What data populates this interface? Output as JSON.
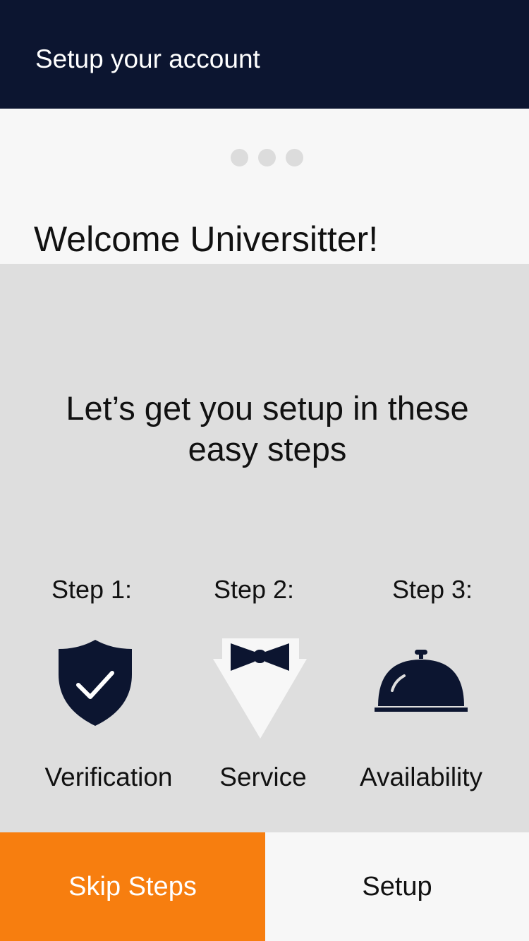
{
  "header": {
    "title": "Setup your account"
  },
  "pager": {
    "total_pages": 3
  },
  "welcome": {
    "title": "Welcome Universitter!"
  },
  "intro": {
    "text": "Let’s get you setup in these easy steps"
  },
  "steps": [
    {
      "label": "Step 1:",
      "name": "Verification",
      "icon": "shield-check-icon"
    },
    {
      "label": "Step 2:",
      "name": "Service",
      "icon": "bowtie-icon"
    },
    {
      "label": "Step 3:",
      "name": "Availability",
      "icon": "service-bell-icon"
    }
  ],
  "footer": {
    "skip_label": "Skip Steps",
    "setup_label": "Setup"
  },
  "colors": {
    "header_bg": "#0c1530",
    "accent": "#f77e0f",
    "icon": "#0c1530",
    "panel_bg": "#dedede",
    "dot": "#dcdcdc"
  }
}
